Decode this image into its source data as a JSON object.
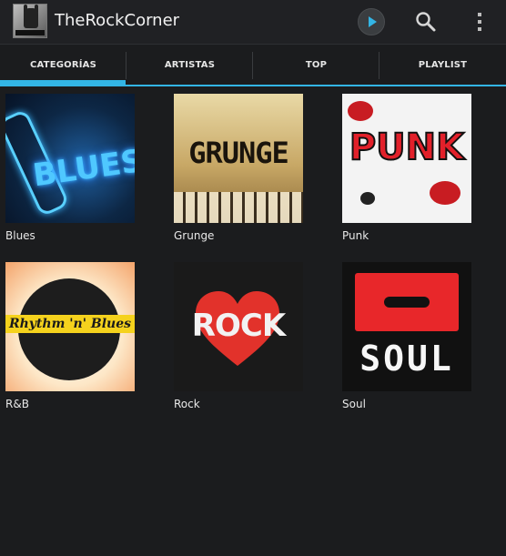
{
  "app": {
    "title": "TheRockCorner",
    "icons": {
      "app": "rock-hand-logo-icon",
      "play": "play-icon",
      "search": "search-icon",
      "overflow": "overflow-menu-icon"
    },
    "accent_color": "#33b5e5"
  },
  "tabs": [
    {
      "label": "CATEGORÍAS",
      "selected": true
    },
    {
      "label": "ARTISTAS",
      "selected": false
    },
    {
      "label": "TOP",
      "selected": false
    },
    {
      "label": "PLAYLIST",
      "selected": false
    }
  ],
  "categories": [
    {
      "name": "Blues",
      "art_text": "BLUES"
    },
    {
      "name": "Grunge",
      "art_text": "GRUNGE"
    },
    {
      "name": "Punk",
      "art_text": "PUNK"
    },
    {
      "name": "R&B",
      "art_text": "Rhythm 'n' Blues"
    },
    {
      "name": "Rock",
      "art_text": "ROCK"
    },
    {
      "name": "Soul",
      "art_text": "SOUL"
    }
  ]
}
